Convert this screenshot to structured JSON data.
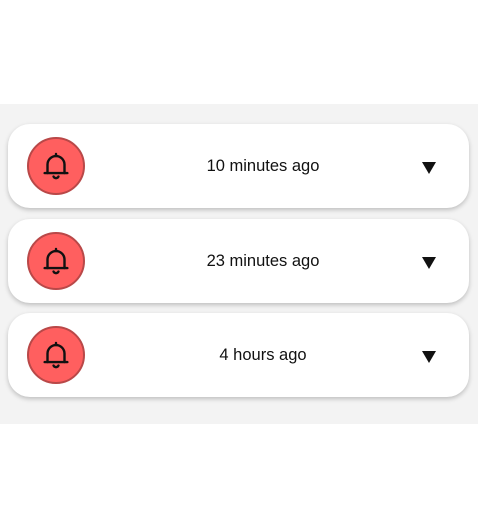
{
  "notifications": [
    {
      "time": "10 minutes ago",
      "icon": "bell-icon",
      "expand_icon": "chevron-down-icon"
    },
    {
      "time": "23 minutes ago",
      "icon": "bell-icon",
      "expand_icon": "chevron-down-icon"
    },
    {
      "time": "4 hours ago",
      "icon": "bell-icon",
      "expand_icon": "chevron-down-icon"
    }
  ],
  "colors": {
    "panel_bg": "#f3f3f3",
    "card_bg": "#ffffff",
    "bell_bg": "#ff5f5f",
    "bell_border": "#b94848",
    "text": "#111111"
  }
}
